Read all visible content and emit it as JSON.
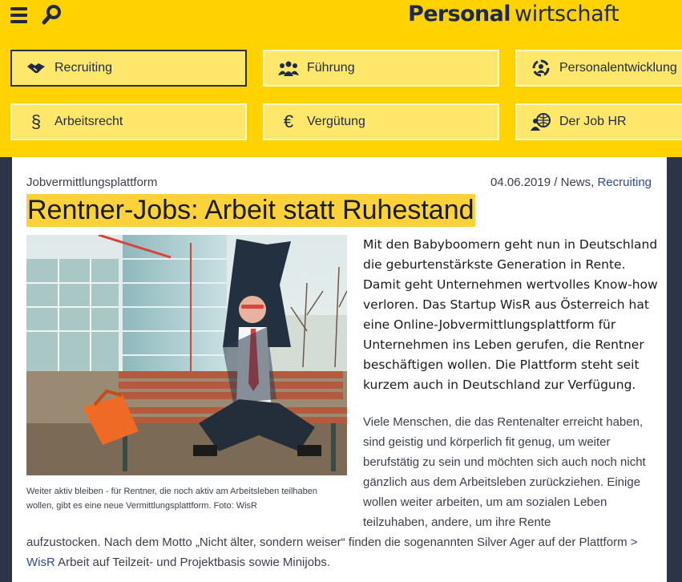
{
  "header": {
    "logo_bold": "Personal",
    "logo_regular": "wirtschaft",
    "nav": [
      {
        "label": "Recruiting",
        "icon": "handshake-icon",
        "active": true
      },
      {
        "label": "Führung",
        "icon": "team-icon",
        "active": false
      },
      {
        "label": "Personalentwicklung",
        "icon": "growth-cycle-icon",
        "active": false
      },
      {
        "label": "Arbeitsrecht",
        "icon": "section-sign-icon",
        "active": false
      },
      {
        "label": "Vergütung",
        "icon": "euro-icon",
        "active": false
      },
      {
        "label": "Der Job HR",
        "icon": "people-globe-icon",
        "active": false
      }
    ],
    "icons": {
      "section": "§",
      "euro": "€"
    }
  },
  "article": {
    "kicker": "Jobvermittlungsplattform",
    "date": "04.06.2019",
    "sep": " / ",
    "category": "News",
    "category_sep": ", ",
    "tag": "Recruiting",
    "title": "Rentner-Jobs: Arbeit statt Ruhestand",
    "caption": "Weiter aktiv bleiben - für Rentner, die noch aktiv am Arbeitsleben teilhaben wollen, gibt es eine neue Vermittlungsplattform. Foto: WisR",
    "lead": "Mit den Babyboomern geht nun in Deutschland die geburtenstärkste Generation in Rente. Damit geht Unternehmen wertvolles Know-how verloren. Das Startup WisR aus Österreich hat eine Online-Jobvermittlungsplattform für Unternehmen ins Leben gerufen, die Rentner beschäftigen wollen. Die Plattform steht seit kurzem auch in Deutschland zur Verfügung.",
    "body1": "Viele Menschen, die das Rentenalter erreicht haben, sind geistig und körperlich fit genug, um weiter berufstätig zu sein und möchten sich auch noch nicht gänzlich aus dem Arbeitsleben zurückziehen. Einige wollen weiter arbeiten, um am sozialen Leben teilzuhaben, andere, um ihre Rente",
    "body2_pre": "aufzustocken. Nach dem Motto „Nicht älter, sondern weiser“ finden die sogenannten Silver Ager auf der Plattform",
    "body2_link": "> WisR",
    "body2_post": "Arbeit auf Teilzeit- und Projektbasis sowie Minijobs."
  },
  "colors": {
    "header_bg": "#ffd200",
    "nav_bg": "#ffe76b",
    "navy": "#1e2a44",
    "title_highlight": "#fbd23a",
    "link": "#2f4b86"
  }
}
